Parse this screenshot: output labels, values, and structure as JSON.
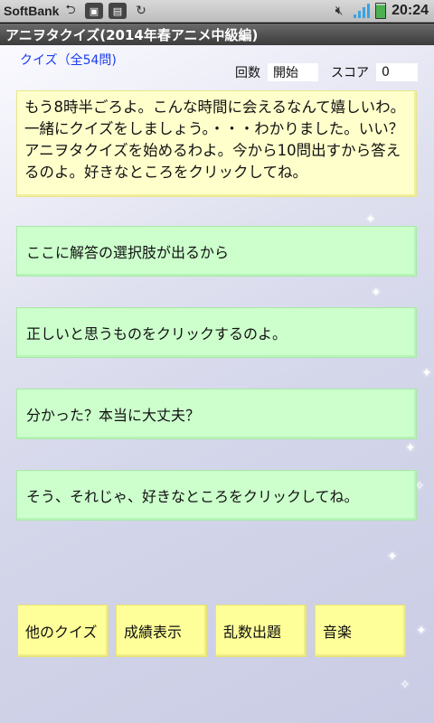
{
  "statusbar": {
    "carrier": "SoftBank",
    "icons": [
      "usb-icon",
      "android-icon",
      "sim-icon",
      "sync-icon",
      "mute-icon",
      "signal-icon",
      "battery-icon"
    ],
    "time": "20:24"
  },
  "app": {
    "title": "アニヲタクイズ(2014年春アニメ中級編)"
  },
  "quiz": {
    "count_label": "クイズ（全54問)",
    "round_label": "回数",
    "round_value": "開始",
    "score_label": "スコア",
    "score_value": "0"
  },
  "question": {
    "text": "もう8時半ごろよ。こんな時間に会えるなんて嬉しいわ。一緒にクイズをしましょう。・・・わかりました。いい？アニヲタクイズを始めるわよ。今から10問出すから答えるのよ。好きなところをクリックしてね。"
  },
  "answers": [
    {
      "text": "ここに解答の選択肢が出るから"
    },
    {
      "text": "正しいと思うものをクリックするのよ。"
    },
    {
      "text": "分かった？本当に大丈夫？"
    },
    {
      "text": "そう、それじゃ、好きなところをクリックしてね。"
    }
  ],
  "buttons": {
    "other_quiz": "他のクイズ",
    "show_score": "成績表示",
    "random": "乱数出題",
    "music": "音楽"
  },
  "colors": {
    "question_bg": "#ffffcc",
    "answer_bg": "#ccffcc",
    "button_bg": "#ffff99",
    "link_blue": "#1a3cf0"
  }
}
